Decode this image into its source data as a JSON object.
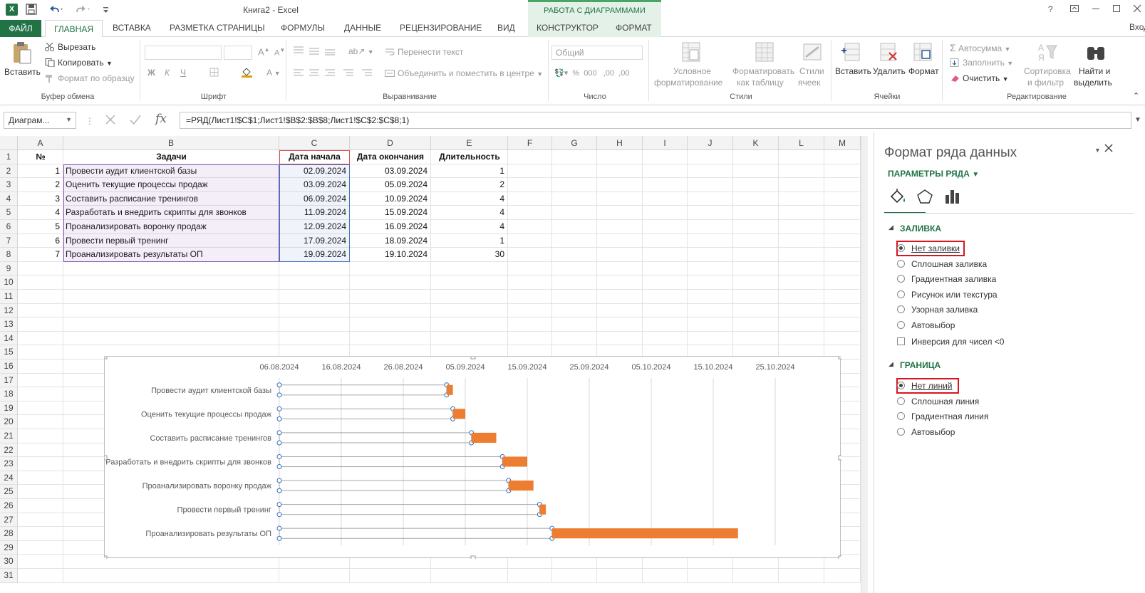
{
  "title_bar": {
    "title": "Книга2 - Excel",
    "context_label": "РАБОТА С ДИАГРАММАМИ",
    "account": "Вход"
  },
  "tabs": [
    "ФАЙЛ",
    "ГЛАВНАЯ",
    "ВСТАВКА",
    "РАЗМЕТКА СТРАНИЦЫ",
    "ФОРМУЛЫ",
    "ДАННЫЕ",
    "РЕЦЕНЗИРОВАНИЕ",
    "ВИД",
    "КОНСТРУКТОР",
    "ФОРМАТ"
  ],
  "ribbon": {
    "clipboard": {
      "paste": "Вставить",
      "cut": "Вырезать",
      "copy": "Копировать",
      "format_painter": "Формат по образцу",
      "label": "Буфер обмена"
    },
    "font": {
      "label": "Шрифт",
      "bold": "Ж",
      "italic": "К",
      "underline": "Ч"
    },
    "alignment": {
      "wrap": "Перенести текст",
      "merge": "Объединить и поместить в центре",
      "label": "Выравнивание"
    },
    "number": {
      "format": "Общий",
      "label": "Число"
    },
    "styles": {
      "conditional_1": "Условное",
      "conditional_2": "форматирование",
      "table_1": "Форматировать",
      "table_2": "как таблицу",
      "cell_1": "Стили",
      "cell_2": "ячеек",
      "label": "Стили"
    },
    "cells": {
      "insert": "Вставить",
      "delete": "Удалить",
      "format": "Формат",
      "label": "Ячейки"
    },
    "editing": {
      "autosum": "Автосумма",
      "fill": "Заполнить",
      "clear": "Очистить",
      "sort_1": "Сортировка",
      "sort_2": "и фильтр",
      "find_1": "Найти и",
      "find_2": "выделить",
      "label": "Редактирование"
    }
  },
  "formula_bar": {
    "name_box": "Диаграм...",
    "fx": "fx",
    "formula": "=РЯД(Лист1!$C$1;Лист1!$B$2:$B$8;Лист1!$C$2:$C$8;1)"
  },
  "sheet": {
    "columns": [
      "A",
      "B",
      "C",
      "D",
      "E",
      "F",
      "G",
      "H",
      "I",
      "J",
      "K",
      "L",
      "M"
    ],
    "rows": [
      "1",
      "2",
      "3",
      "4",
      "5",
      "6",
      "7",
      "8",
      "9",
      "10",
      "11",
      "12",
      "13",
      "14",
      "15",
      "16",
      "17",
      "18",
      "19",
      "20",
      "21",
      "22",
      "23",
      "24",
      "25",
      "26",
      "27",
      "28",
      "29",
      "30",
      "31"
    ],
    "header": [
      "№",
      "Задачи",
      "Дата начала",
      "Дата окончания",
      "Длительность"
    ],
    "data": [
      [
        "1",
        "Провести аудит клиентской базы",
        "02.09.2024",
        "03.09.2024",
        "1"
      ],
      [
        "2",
        "Оценить текущие процессы продаж",
        "03.09.2024",
        "05.09.2024",
        "2"
      ],
      [
        "3",
        "Составить расписание тренингов",
        "06.09.2024",
        "10.09.2024",
        "4"
      ],
      [
        "4",
        "Разработать и внедрить скрипты для звонков",
        "11.09.2024",
        "15.09.2024",
        "4"
      ],
      [
        "5",
        "Проанализировать воронку продаж",
        "12.09.2024",
        "16.09.2024",
        "4"
      ],
      [
        "6",
        "Провести первый тренинг",
        "17.09.2024",
        "18.09.2024",
        "1"
      ],
      [
        "7",
        "Проанализировать результаты ОП",
        "19.09.2024",
        "19.10.2024",
        "30"
      ]
    ]
  },
  "chart_data": {
    "type": "bar",
    "orientation": "horizontal-stacked",
    "categories": [
      "Провести аудит клиентской базы",
      "Оценить текущие процессы продаж",
      "Составить расписание тренингов",
      "Разработать и внедрить скрипты для звонков",
      "Проанализировать воронку продаж",
      "Провести первый тренинг",
      "Проанализировать результаты ОП"
    ],
    "series": [
      {
        "values": [
          "02.09.2024",
          "03.09.2024",
          "06.09.2024",
          "11.09.2024",
          "12.09.2024",
          "17.09.2024",
          "19.09.2024"
        ],
        "fill": "none",
        "selected": true
      },
      {
        "values": [
          1,
          2,
          4,
          4,
          4,
          1,
          30
        ],
        "color": "#ED7D31"
      }
    ],
    "x_ticks": [
      "06.08.2024",
      "16.08.2024",
      "26.08.2024",
      "05.09.2024",
      "15.09.2024",
      "25.09.2024",
      "05.10.2024",
      "15.10.2024",
      "25.10.2024"
    ],
    "xlim": [
      "06.08.2024",
      "04.11.2024"
    ],
    "x_axis_position": "top",
    "grid": true,
    "legend": "none"
  },
  "pane": {
    "title": "Формат ряда данных",
    "subtitle": "ПАРАМЕТРЫ РЯДА",
    "fill_section": "ЗАЛИВКА",
    "fill_options": [
      "Нет заливки",
      "Сплошная заливка",
      "Градиентная заливка",
      "Рисунок или текстура",
      "Узорная заливка",
      "Автовыбор"
    ],
    "fill_selected": 0,
    "invert": "Инверсия для чисел <0",
    "border_section": "ГРАНИЦА",
    "border_options": [
      "Нет линий",
      "Сплошная линия",
      "Градиентная линия",
      "Автовыбор"
    ],
    "border_selected": 0
  },
  "colors": {
    "excel_green": "#217346",
    "bar_orange": "#ED7D31",
    "highlight_red": "#D9141E"
  }
}
